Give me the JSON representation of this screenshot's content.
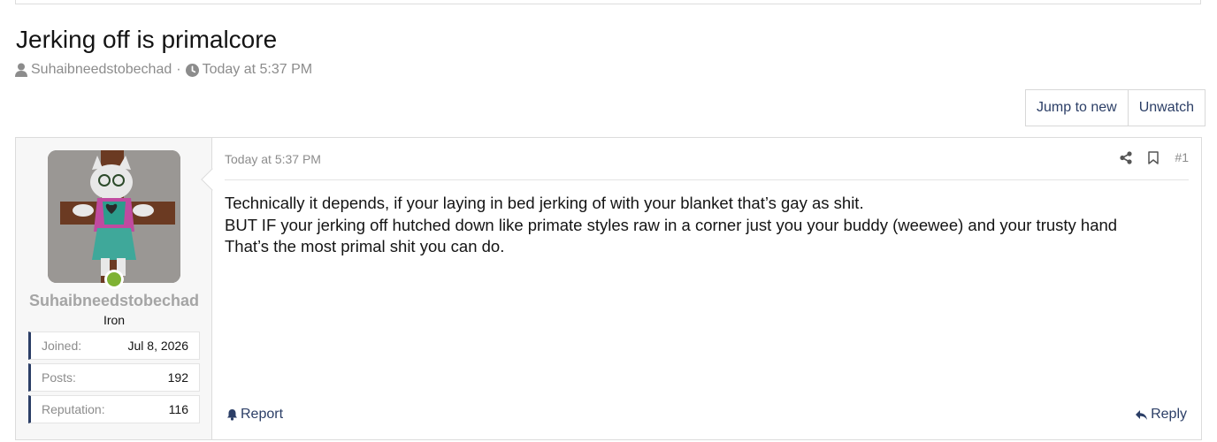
{
  "thread": {
    "title": "Jerking off is primalcore",
    "author": "Suhaibneedstobechad",
    "separator": "·",
    "time": "Today at 5:37 PM"
  },
  "buttons": {
    "jump_to_new": "Jump to new",
    "unwatch": "Unwatch"
  },
  "post": {
    "user": {
      "name": "Suhaibneedstobechad",
      "rank": "Iron",
      "stats": [
        {
          "key": "Joined:",
          "value": "Jul 8, 2026"
        },
        {
          "key": "Posts:",
          "value": "192"
        },
        {
          "key": "Reputation:",
          "value": "116"
        }
      ]
    },
    "date": "Today at 5:37 PM",
    "number": "#1",
    "lines": [
      "Technically it depends, if your laying in bed jerking of with your blanket that’s gay as shit.",
      "BUT IF your jerking off hutched down like primate styles raw in a corner just you your buddy (weewee) and your trusty hand",
      "That’s the most primal shit you can do."
    ],
    "report_label": "Report",
    "reply_label": "Reply"
  },
  "icons": {
    "user": "user-icon",
    "clock": "clock-icon",
    "share": "share-icon",
    "bookmark": "bookmark-icon",
    "report": "bell-icon",
    "reply": "reply-icon"
  },
  "colors": {
    "link": "#2b3e66",
    "muted": "#8c8c8c",
    "online": "#7fb234",
    "stat_accent": "#2b3e66"
  }
}
